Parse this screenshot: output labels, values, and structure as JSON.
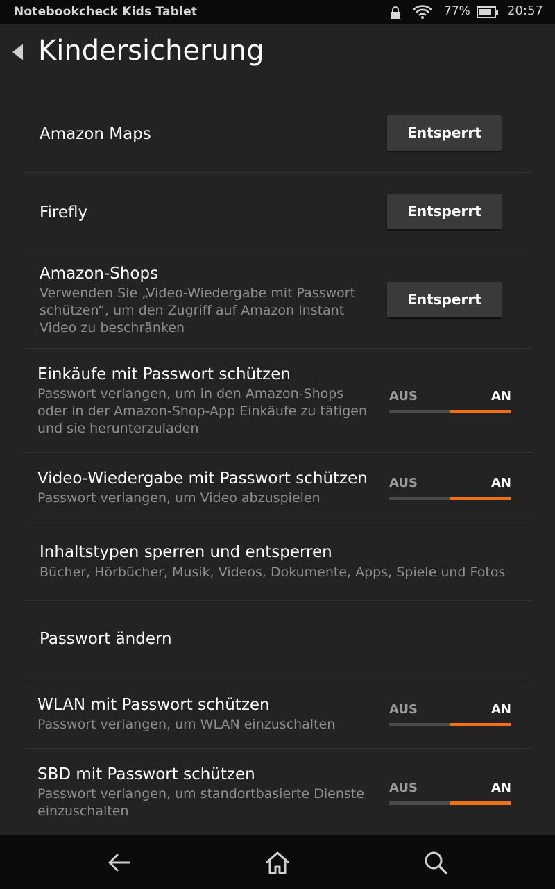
{
  "status": {
    "device": "Notebookcheck Kids Tablet",
    "battery_pct": "77%",
    "time": "20:57",
    "icons": [
      "lock-icon",
      "wifi-icon",
      "battery-icon"
    ]
  },
  "header": {
    "title": "Kindersicherung"
  },
  "rows": [
    {
      "label": "Amazon Maps",
      "button": "Entsperrt"
    },
    {
      "label": "Firefly",
      "button": "Entsperrt"
    },
    {
      "label": "Amazon-Shops",
      "desc": "Verwenden Sie „Video-Wiedergabe mit Passwort schützen“, um den Zugriff auf Amazon Instant Video zu beschränken",
      "button": "Entsperrt"
    },
    {
      "label": "Einkäufe mit Passwort schützen",
      "desc": "Passwort verlangen, um in den Amazon-Shops oder in der Amazon-Shop-App Einkäufe zu tätigen und sie herunterzuladen",
      "toggle_off": "AUS",
      "toggle_on": "AN",
      "state": "on"
    },
    {
      "label": "Video-Wiedergabe mit Passwort schützen",
      "desc": "Passwort verlangen, um Video abzuspielen",
      "toggle_off": "AUS",
      "toggle_on": "AN",
      "state": "on"
    },
    {
      "label": "Inhaltstypen sperren und entsperren",
      "desc": "Bücher, Hörbücher, Musik, Videos, Dokumente, Apps, Spiele und Fotos"
    },
    {
      "label": "Passwort ändern"
    },
    {
      "label": "WLAN mit Passwort schützen",
      "desc": "Passwort verlangen, um WLAN einzuschalten",
      "toggle_off": "AUS",
      "toggle_on": "AN",
      "state": "on"
    },
    {
      "label": "SBD mit Passwort schützen",
      "desc": "Passwort verlangen, um standortbasierte Dienste einzuschalten",
      "toggle_off": "AUS",
      "toggle_on": "AN",
      "state": "on"
    }
  ],
  "navbar": {
    "icons": [
      "back-arrow-icon",
      "home-icon",
      "search-icon"
    ]
  },
  "colors": {
    "accent": "#f26f12",
    "background": "#232323",
    "bar": "#0a0a0a"
  }
}
